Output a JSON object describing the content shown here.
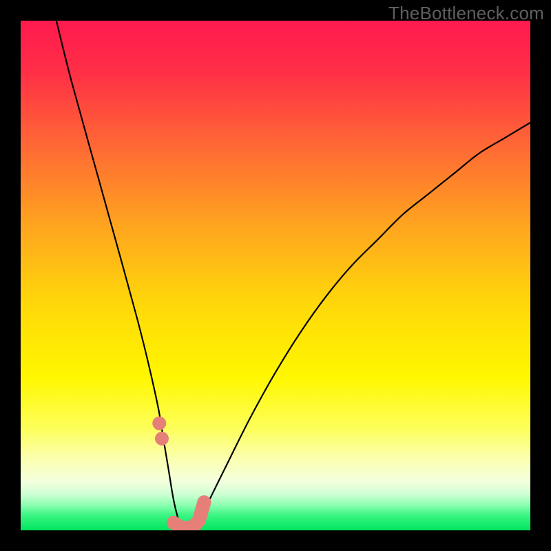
{
  "watermark": "TheBottleneck.com",
  "colors": {
    "frame": "#000000",
    "curve": "#000000",
    "dots": "#e77f79",
    "green": "#00e55e"
  },
  "chart_data": {
    "type": "line",
    "title": "",
    "xlabel": "",
    "ylabel": "",
    "xlim": [
      0,
      100
    ],
    "ylim": [
      0,
      100
    ],
    "series": [
      {
        "name": "bottleneck-curve",
        "x": [
          7,
          10,
          15,
          20,
          23,
          25,
          27,
          28,
          29,
          30,
          31,
          32,
          33,
          34,
          36,
          40,
          45,
          50,
          55,
          60,
          65,
          70,
          75,
          80,
          85,
          90,
          95,
          100
        ],
        "y": [
          100,
          88,
          70,
          52,
          41,
          33,
          24,
          18,
          12,
          6,
          2,
          0,
          0,
          1,
          4,
          12,
          22,
          31,
          39,
          46,
          52,
          57,
          62,
          66,
          70,
          74,
          77,
          80
        ]
      }
    ],
    "highlight_dots": {
      "name": "salmon-dots",
      "x": [
        27.2,
        27.7,
        30.0,
        31.0,
        32.0,
        33.0,
        34.0,
        35.0,
        36.0
      ],
      "y": [
        21,
        18,
        1.5,
        0.8,
        0.5,
        0.5,
        0.8,
        2.0,
        5.5
      ]
    },
    "gradient_stops": [
      {
        "pos": 0.0,
        "color": "#ff1a4f"
      },
      {
        "pos": 0.1,
        "color": "#ff2f46"
      },
      {
        "pos": 0.25,
        "color": "#ff6a34"
      },
      {
        "pos": 0.4,
        "color": "#ffa41f"
      },
      {
        "pos": 0.55,
        "color": "#ffd60a"
      },
      {
        "pos": 0.7,
        "color": "#fff700"
      },
      {
        "pos": 0.8,
        "color": "#fdff5a"
      },
      {
        "pos": 0.86,
        "color": "#fbffb0"
      },
      {
        "pos": 0.905,
        "color": "#f4ffde"
      },
      {
        "pos": 0.93,
        "color": "#ccffd2"
      },
      {
        "pos": 0.95,
        "color": "#8dffb0"
      },
      {
        "pos": 0.97,
        "color": "#3cf584"
      },
      {
        "pos": 1.0,
        "color": "#00e55e"
      }
    ]
  }
}
